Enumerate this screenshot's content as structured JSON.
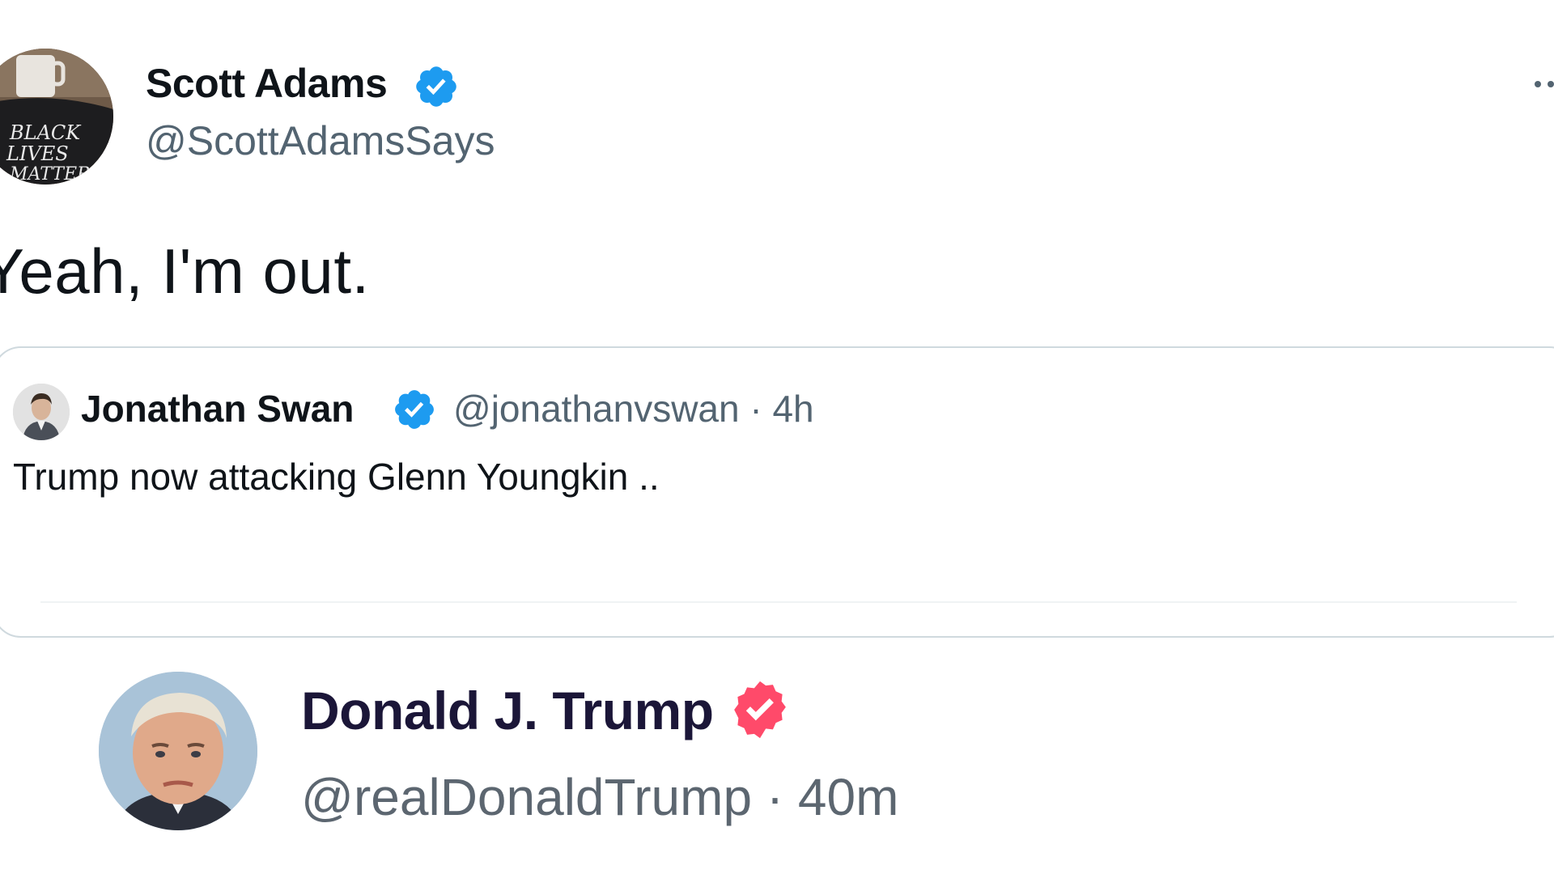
{
  "main_tweet": {
    "author_name": "Scott Adams",
    "author_handle": "@ScottAdamsSays",
    "text": "Yeah, I'm out.",
    "avatar_icon": "user-avatar-icon",
    "badge_icon": "verified-badge-icon",
    "more_icon": "more-options-icon"
  },
  "quoted_tweet": {
    "author_name": "Jonathan Swan",
    "author_handle": "@jonathanvswan · 4h",
    "text": "Trump now attacking Glenn Youngkin ..",
    "badge_icon": "verified-badge-icon"
  },
  "embedded_post": {
    "author_name": "Donald J. Trump",
    "author_handle": "@realDonaldTrump · 40m",
    "badge_icon": "verified-badge-icon"
  },
  "colors": {
    "twitter_verified": "#1d9bf0",
    "truth_verified": "#ff4a6a",
    "secondary_text": "#536471",
    "card_border": "#cfd9de"
  }
}
